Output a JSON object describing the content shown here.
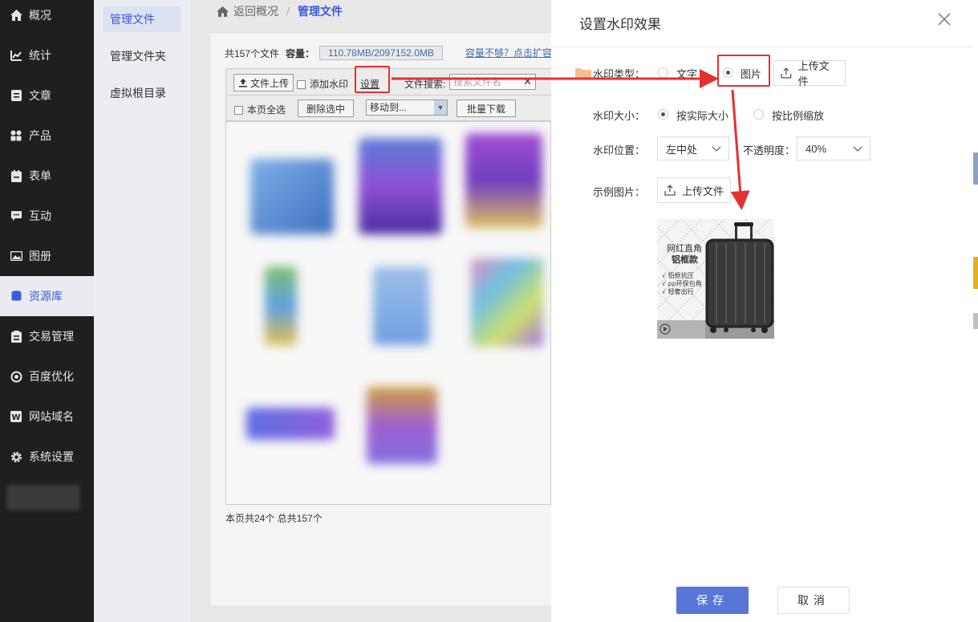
{
  "nav": {
    "items": [
      {
        "label": "概况",
        "icon": "home-icon"
      },
      {
        "label": "统计",
        "icon": "chart-icon"
      },
      {
        "label": "文章",
        "icon": "article-icon"
      },
      {
        "label": "产品",
        "icon": "product-icon"
      },
      {
        "label": "表单",
        "icon": "form-icon"
      },
      {
        "label": "互动",
        "icon": "chat-icon"
      },
      {
        "label": "图册",
        "icon": "album-icon"
      },
      {
        "label": "资源库",
        "icon": "database-icon"
      },
      {
        "label": "交易管理",
        "icon": "trade-icon"
      },
      {
        "label": "百度优化",
        "icon": "seo-icon"
      },
      {
        "label": "网站域名",
        "icon": "domain-icon"
      },
      {
        "label": "系统设置",
        "icon": "gear-icon"
      }
    ],
    "active_index": 7
  },
  "subnav": {
    "items": [
      "管理文件",
      "管理文件夹",
      "虚拟根目录"
    ],
    "active_index": 0
  },
  "breadcrumb": {
    "back": "返回概况",
    "sep": "/",
    "current": "管理文件"
  },
  "files": {
    "count_text": "共157个文件",
    "capacity_label": "容量：",
    "capacity_value": "110.78MB/2097152.0MB",
    "more_link": "容量不够？点击扩容",
    "upload_btn": "文件上传",
    "add_watermark": "添加水印",
    "settings_link": "设置",
    "search_label": "文件搜索:",
    "search_placeholder": "搜索文件名",
    "select_all": "本页全选",
    "delete_selected": "删除选中",
    "move_to": "移动到...",
    "batch_download": "批量下载",
    "pager": "本页共24个 总共157个"
  },
  "dialog": {
    "title": "设置水印效果",
    "type_label": "水印类型：",
    "type_text": "文字",
    "type_image": "图片",
    "upload_file": "上传文件",
    "size_label": "水印大小：",
    "size_actual": "按实际大小",
    "size_scale": "按比例缩放",
    "position_label": "水印位置：",
    "position_value": "左中处",
    "opacity_label": "不透明度：",
    "opacity_value": "40%",
    "sample_label": "示例图片：",
    "sample_upload": "上传文件",
    "save": "保存",
    "cancel": "取消"
  },
  "sample_image": {
    "line1": "网红直角",
    "line2": "铝框款",
    "bullet1": "√ 铝框抗压",
    "bullet2": "√ pp环保包角",
    "bullet3": "√ 轻奢出行"
  },
  "colors": {
    "accent": "#3b5bdb",
    "save_button": "#5677d6",
    "annotation_red": "#e53030",
    "nav_bg": "#1f1f1f"
  }
}
